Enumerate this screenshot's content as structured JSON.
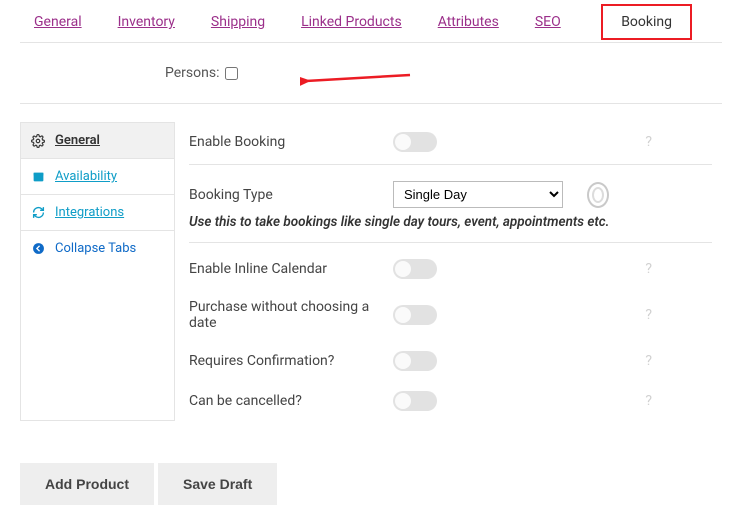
{
  "top_tabs": {
    "general": "General",
    "inventory": "Inventory",
    "shipping": "Shipping",
    "linked_products": "Linked Products",
    "attributes": "Attributes",
    "seo": "SEO",
    "booking": "Booking"
  },
  "persons": {
    "label": "Persons:"
  },
  "sidebar": {
    "items": [
      {
        "label": "General"
      },
      {
        "label": "Availability"
      },
      {
        "label": "Integrations"
      },
      {
        "label": "Collapse Tabs"
      }
    ]
  },
  "fields": {
    "enable_booking": "Enable Booking",
    "booking_type": "Booking Type",
    "booking_type_value": "Single Day",
    "booking_type_hint": "Use this to take bookings like single day tours, event, appointments etc.",
    "enable_inline_calendar": "Enable Inline Calendar",
    "purchase_without_date": "Purchase without choosing a date",
    "requires_confirmation": "Requires Confirmation?",
    "can_be_cancelled": "Can be cancelled?"
  },
  "actions": {
    "add_product": "Add Product",
    "save_draft": "Save Draft"
  }
}
